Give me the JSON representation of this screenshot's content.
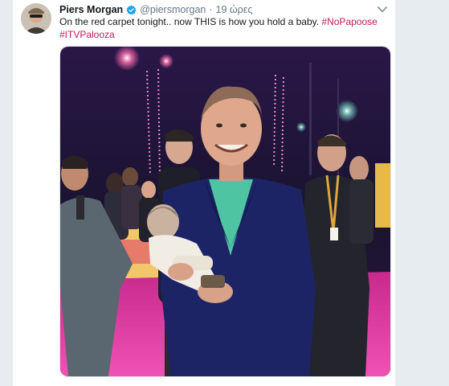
{
  "tweet": {
    "author_name": "Piers Morgan",
    "handle": "@piersmorgan",
    "separator": "·",
    "timestamp": "19 ώρες",
    "text_main": "On the red carpet tonight.. now THIS is how you hold a baby. ",
    "hashtags": [
      "#NoPapoose",
      "#ITVPalooza"
    ]
  },
  "icons": {
    "verified": "verified-badge-icon",
    "menu": "chevron-down-icon"
  },
  "colors": {
    "hashtag": "#c2185b",
    "verified": "#1da1f2",
    "carpet": "#e0359c",
    "jacket": "#1c2466",
    "backdrop": "#1b1336"
  }
}
